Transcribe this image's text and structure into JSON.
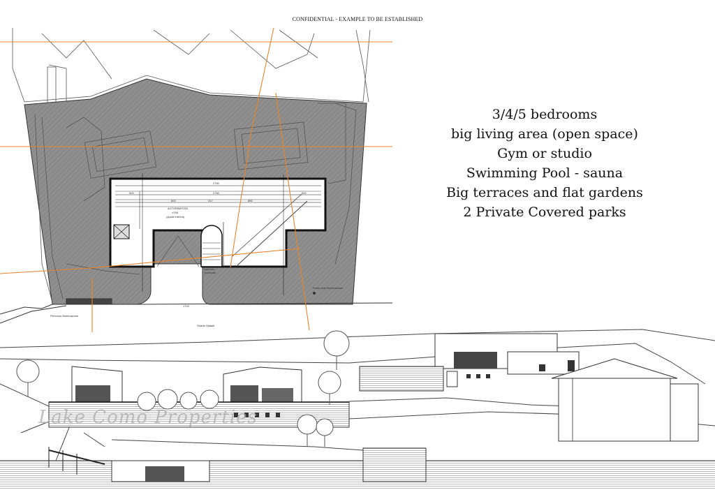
{
  "header": {
    "confidential": "CONFIDENTIAL - EXAMPLE TO BE ESTABLISHED"
  },
  "features": [
    "3/4/5 bedrooms",
    "big living area (open space)",
    "Gym or studio",
    "Swimming Pool - sauna",
    "Big terraces and flat gardens",
    "2 Private Covered parks"
  ],
  "watermark": {
    "text": "Lake Como Properties"
  },
  "plan": {
    "dims": [
      "2760",
      "2760",
      "500",
      "600",
      "317",
      "850",
      "500",
      "1700"
    ],
    "room_label": "AUTORIMESSA",
    "room_sub": "±758",
    "room_note": "(quota interna)",
    "entrance_label": "Ingresso",
    "entrance_sub": "pedonale",
    "lower_label": "Posto auto illuminazione",
    "left_label": "Percorso illuminazione",
    "bottom_label": "Strada Statale"
  }
}
